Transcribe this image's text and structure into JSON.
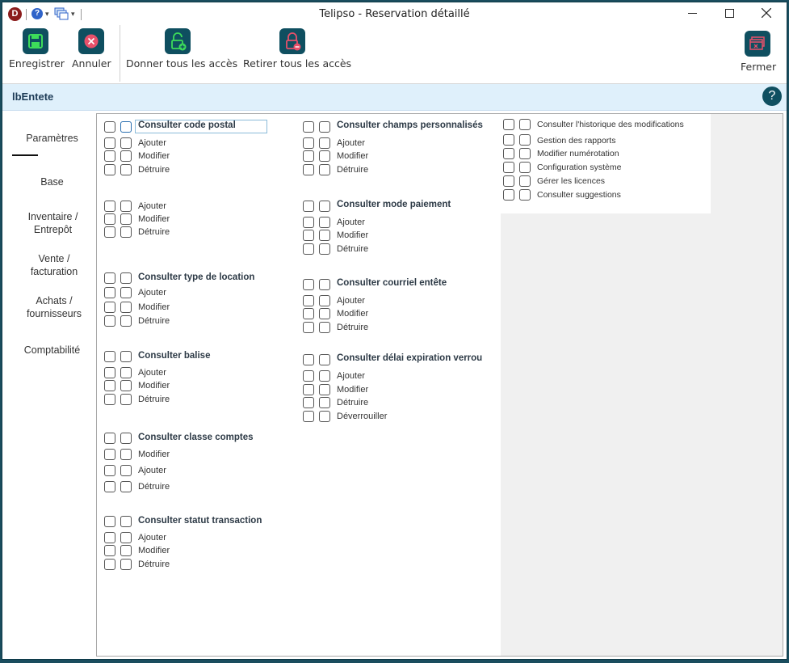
{
  "window": {
    "title": "Telipso - Reservation détaillé",
    "app_logo_letter": "D",
    "help_letter": "?"
  },
  "ribbon": {
    "save": "Enregistrer",
    "cancel": "Annuler",
    "grant_all": "Donner tous les accès",
    "revoke_all": "Retirer tous les accès",
    "close": "Fermer"
  },
  "header": {
    "label": "lbEntete",
    "help": "?"
  },
  "tabs": [
    {
      "label": "Paramètres"
    },
    {
      "label": "Base"
    },
    {
      "label": "Inventaire / Entrepôt"
    },
    {
      "label": "Vente / facturation"
    },
    {
      "label": "Achats / fournisseurs"
    },
    {
      "label": "Comptabilité"
    }
  ],
  "column1": {
    "g1": {
      "title": "Consulter code postal",
      "items": [
        "Ajouter",
        "Modifier",
        "Détruire"
      ]
    },
    "g2": {
      "items": [
        "Ajouter",
        "Modifier",
        "Détruire"
      ]
    },
    "g3": {
      "title": "Consulter type de location",
      "items": [
        "Ajouter",
        "Modifier",
        "Détruire"
      ]
    },
    "g4": {
      "title": "Consulter balise",
      "items": [
        "Ajouter",
        "Modifier",
        "Détruire"
      ]
    },
    "g5": {
      "title": "Consulter classe comptes",
      "items": [
        "Modifier",
        "Ajouter",
        "Détruire"
      ]
    },
    "g6": {
      "title": "Consulter statut transaction",
      "items": [
        "Ajouter",
        "Modifier",
        "Détruire"
      ]
    }
  },
  "column2": {
    "g1": {
      "title": "Consulter champs personnalisés",
      "items": [
        "Ajouter",
        "Modifier",
        "Détruire"
      ]
    },
    "g2": {
      "title": "Consulter mode paiement",
      "items": [
        "Ajouter",
        "Modifier",
        "Détruire"
      ]
    },
    "g3": {
      "title": "Consulter courriel entête",
      "items": [
        "Ajouter",
        "Modifier",
        "Détruire"
      ]
    },
    "g4": {
      "title": "Consulter délai expiration verrou",
      "items": [
        "Ajouter",
        "Modifier",
        "Détruire",
        "Déverrouiller"
      ]
    }
  },
  "column3": {
    "items": [
      "Consulter l'historique des modifications",
      "Gestion des rapports",
      "Modifier numérotation",
      "Configuration système",
      "Gérer les licences",
      "Consulter suggestions"
    ]
  }
}
